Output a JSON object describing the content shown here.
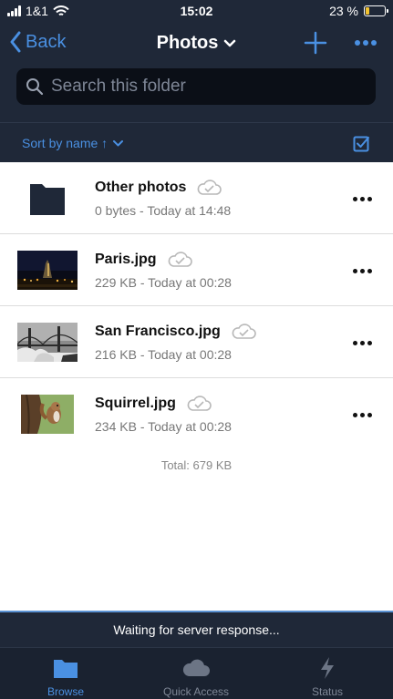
{
  "status_bar": {
    "carrier": "1&1",
    "time": "15:02",
    "battery_percent": "23 %",
    "battery_level": 0.23
  },
  "nav": {
    "back_label": "Back",
    "title": "Photos",
    "add_icon": "plus-icon",
    "more_icon": "ellipsis-icon"
  },
  "search": {
    "placeholder": "Search this folder",
    "value": ""
  },
  "sort": {
    "label": "Sort by name ↑"
  },
  "files": [
    {
      "name": "Other photos",
      "meta": "0 bytes - Today at 14:48",
      "kind": "folder"
    },
    {
      "name": "Paris.jpg",
      "meta": "229 KB - Today at 00:28",
      "kind": "image"
    },
    {
      "name": "San Francisco.jpg",
      "meta": "216 KB - Today at 00:28",
      "kind": "image"
    },
    {
      "name": "Squirrel.jpg",
      "meta": "234 KB - Today at 00:28",
      "kind": "image"
    }
  ],
  "total": "Total: 679 KB",
  "status_message": "Waiting for server response...",
  "tabs": [
    {
      "label": "Browse",
      "icon": "folder-icon",
      "active": true
    },
    {
      "label": "Quick Access",
      "icon": "cloud-icon",
      "active": false
    },
    {
      "label": "Status",
      "icon": "lightning-icon",
      "active": false
    }
  ],
  "colors": {
    "header_bg": "#1f2838",
    "accent": "#4a90e2",
    "battery": "#f2c230"
  }
}
